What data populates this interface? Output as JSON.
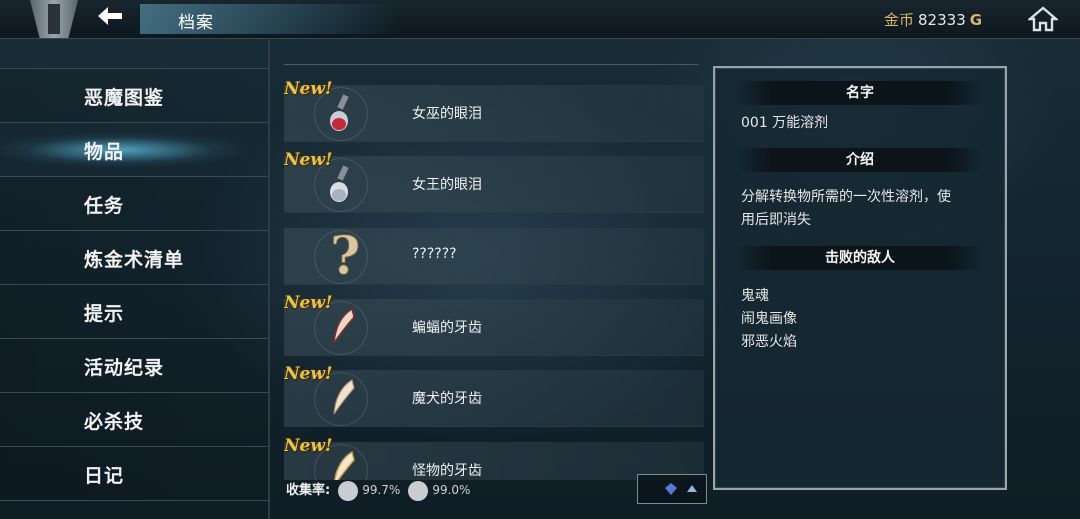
{
  "header": {
    "title": "档案",
    "coins_label": "金币",
    "coins_value": "82333",
    "coins_unit": "G"
  },
  "menu": {
    "items": [
      {
        "label": "恶魔图鉴"
      },
      {
        "label": "物品",
        "active": true
      },
      {
        "label": "任务"
      },
      {
        "label": "炼金术清单"
      },
      {
        "label": "提示"
      },
      {
        "label": "活动纪录"
      },
      {
        "label": "必杀技"
      },
      {
        "label": "日记"
      }
    ]
  },
  "items": [
    {
      "name": "女巫的眼泪",
      "new": "New!",
      "icon": "red-potion-icon"
    },
    {
      "name": "女王的眼泪",
      "new": "New!",
      "icon": "silver-potion-icon"
    },
    {
      "name": "??????",
      "new": "",
      "icon": "question-mark-icon"
    },
    {
      "name": "蝙蝠的牙齿",
      "new": "New!",
      "icon": "fang-icon"
    },
    {
      "name": "魔犬的牙齿",
      "new": "New!",
      "icon": "fang-icon"
    },
    {
      "name": "怪物的牙齿",
      "new": "New!",
      "icon": "fang-icon"
    }
  ],
  "collection": {
    "label": "收集率:",
    "rate1": "99.7%",
    "rate2": "99.0%"
  },
  "detail": {
    "name_header": "名字",
    "name_value": "001 万能溶剂",
    "desc_header": "介绍",
    "desc_line1": "分解转换物所需的一次性溶剂，使",
    "desc_line2": "用后即消失",
    "enemies_header": "击败的敌人",
    "enemies": [
      "鬼魂",
      "闹鬼画像",
      "邪恶火焰"
    ]
  },
  "colors": {
    "accent_gold": "#d7b56a",
    "new_tag": "#e8c24a",
    "active_glow": "#5ab4d2"
  }
}
